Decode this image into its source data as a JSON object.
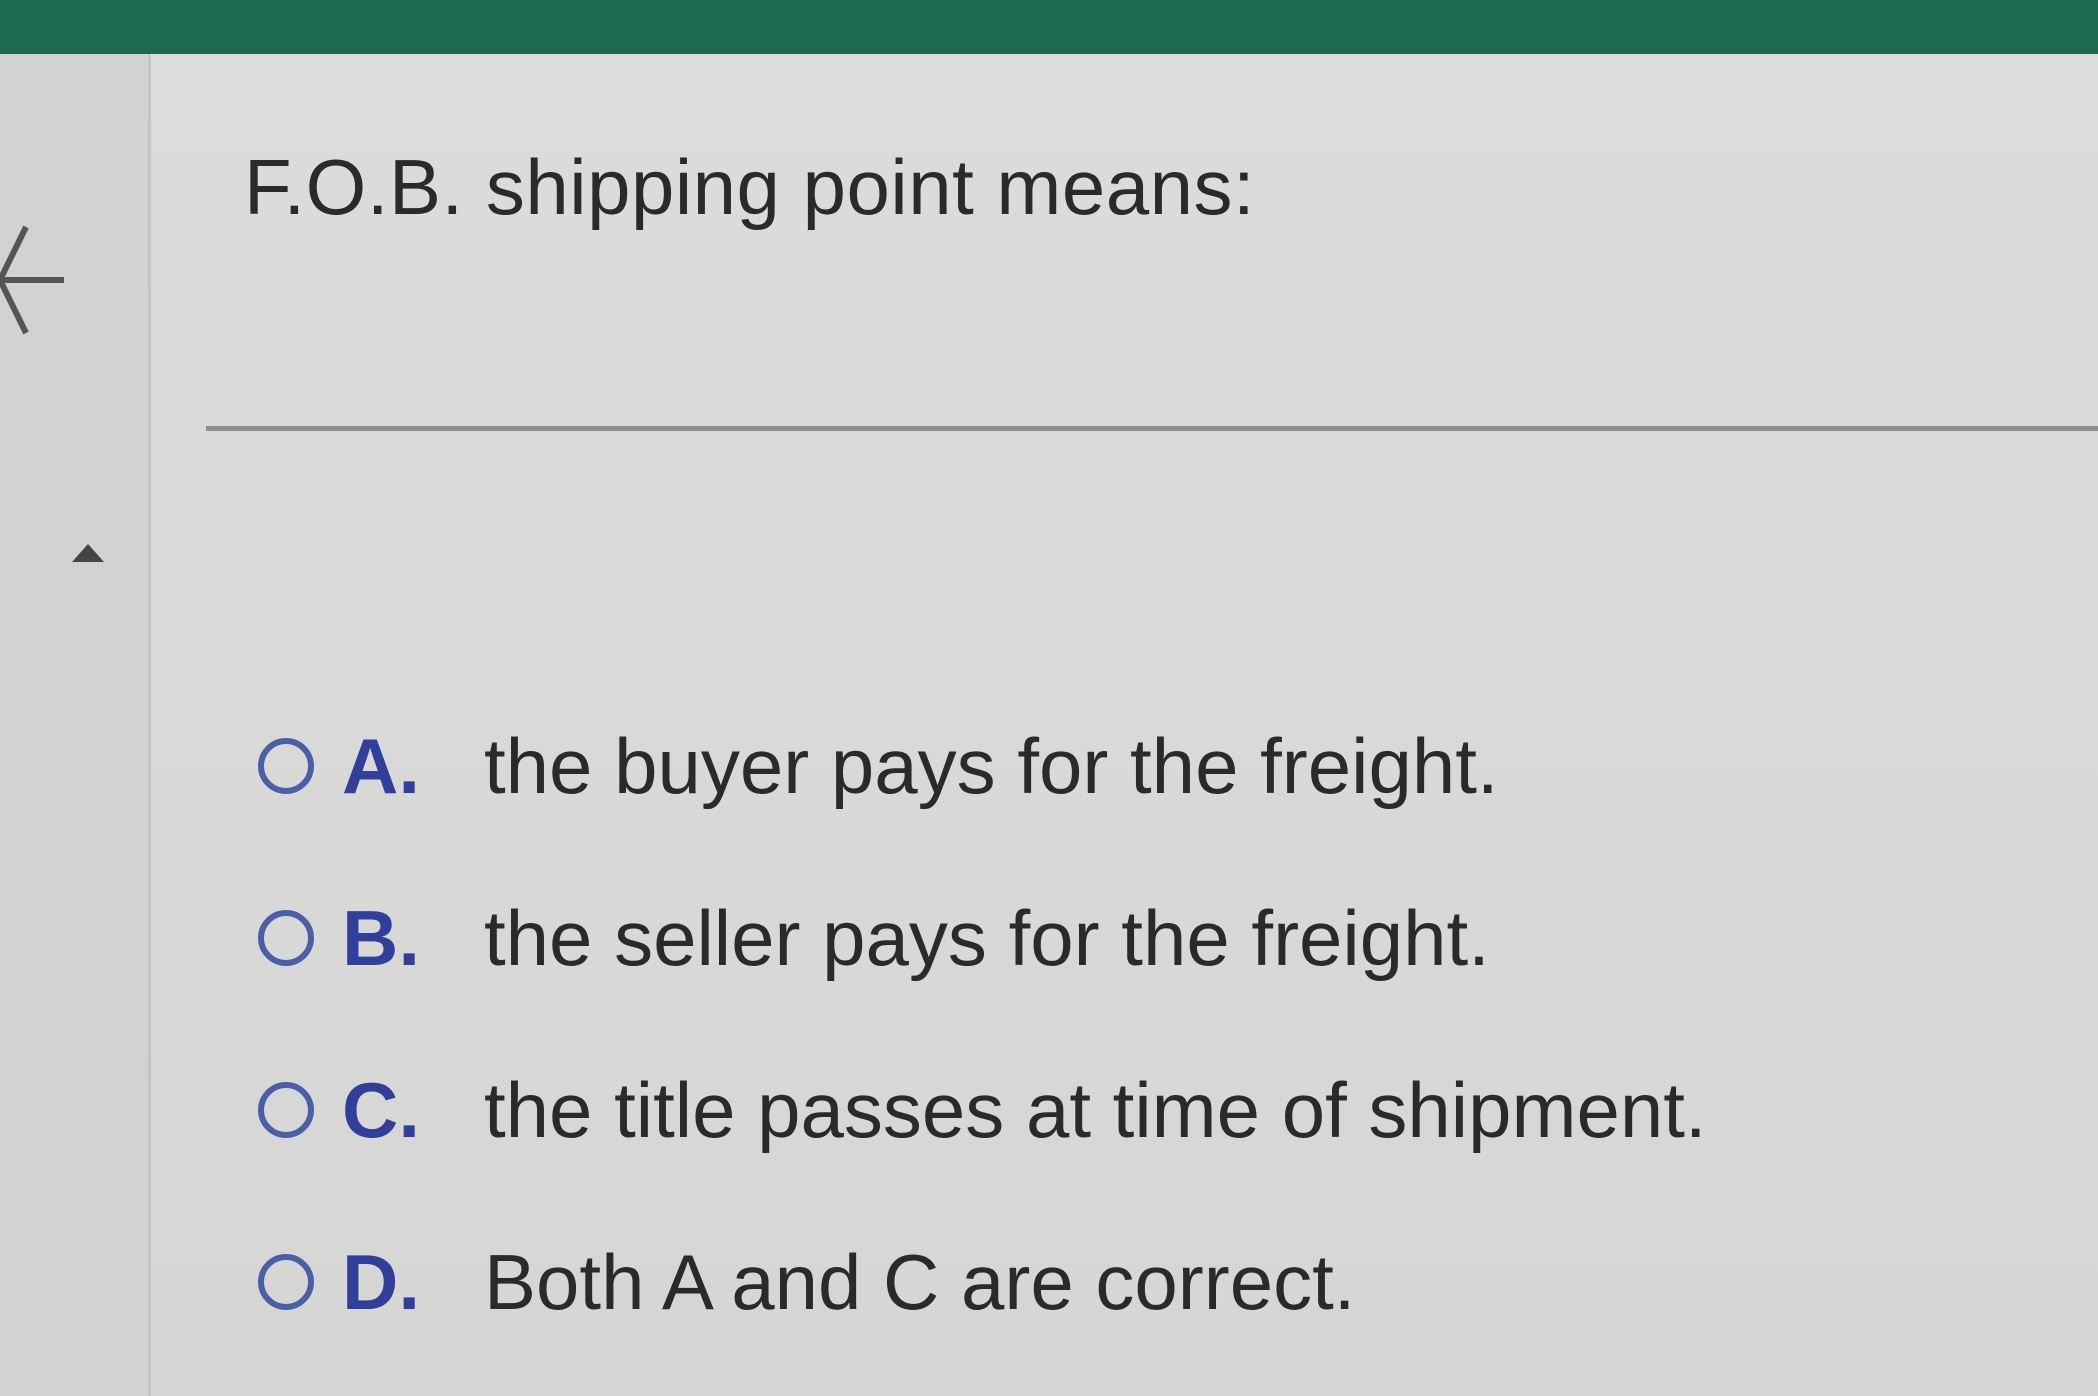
{
  "colors": {
    "header_bar": "#1d6a4e",
    "accent_letter": "#2f3f9a",
    "radio_border": "#4a5fa8",
    "text": "#2a2a2a"
  },
  "question": {
    "text": "F.O.B. shipping point means:"
  },
  "options": [
    {
      "letter": "A.",
      "text": "the buyer pays for the freight.",
      "selected": false
    },
    {
      "letter": "B.",
      "text": "the seller pays for the freight.",
      "selected": false
    },
    {
      "letter": "C.",
      "text": "the title passes at time of shipment.",
      "selected": false
    },
    {
      "letter": "D.",
      "text": "Both A and C are correct.",
      "selected": false
    }
  ],
  "icons": {
    "back": "arrow-left-icon",
    "collapse": "caret-up-icon"
  }
}
